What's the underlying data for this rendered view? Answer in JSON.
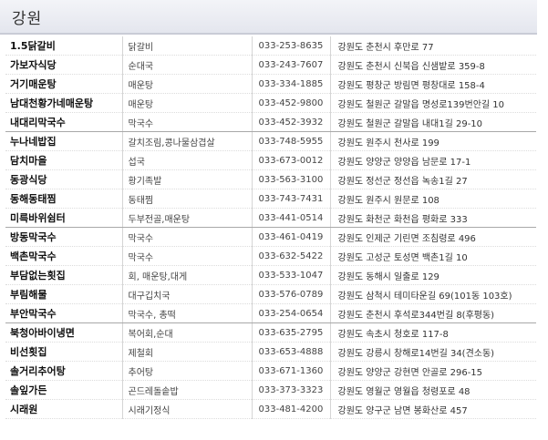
{
  "header": {
    "title": "강원"
  },
  "restaurants": [
    {
      "name": "1.5닭갈비",
      "food": "닭갈비",
      "phone": "033-253-8635",
      "address": "강원도 춘천시 후만로 77"
    },
    {
      "name": "가보자식당",
      "food": "순대국",
      "phone": "033-243-7607",
      "address": "강원도 춘천시 신북읍 신샘밭로 359-8"
    },
    {
      "name": "거기매운탕",
      "food": "매운탕",
      "phone": "033-334-1885",
      "address": "강원도 평창군 방림면 평창대로 158-4"
    },
    {
      "name": "남대천황가네매운탕",
      "food": "매운탕",
      "phone": "033-452-9800",
      "address": "강원도 철원군 갈말읍 명성로139번안길 10"
    },
    {
      "name": "내대리막국수",
      "food": "막국수",
      "phone": "033-452-3932",
      "address": "강원도 철원군 갈말읍 내대1길 29-10"
    },
    {
      "name": "누나네밥집",
      "food": "갈치조림,콩나물삼겹살",
      "phone": "033-748-5955",
      "address": "강원도 원주시 천사로 199"
    },
    {
      "name": "담치마을",
      "food": "섭국",
      "phone": "033-673-0012",
      "address": "강원도 양양군 양양읍 남문로 17-1"
    },
    {
      "name": "동광식당",
      "food": "황기족발",
      "phone": "033-563-3100",
      "address": "강원도 정선군 정선읍 녹송1길 27"
    },
    {
      "name": "동해동태찜",
      "food": "동태찜",
      "phone": "033-743-7431",
      "address": "강원도 원주시 원문로 108"
    },
    {
      "name": "미륵바위쉼터",
      "food": "두부전골,매운탕",
      "phone": "033-441-0514",
      "address": "강원도 화천군 화천읍 평화로 333"
    },
    {
      "name": "방동막국수",
      "food": "막국수",
      "phone": "033-461-0419",
      "address": "강원도 인제군 기린면 조침령로 496"
    },
    {
      "name": "백촌막국수",
      "food": "막국수",
      "phone": "033-632-5422",
      "address": "강원도 고성군 토성면 백촌1길 10"
    },
    {
      "name": "부담없는횟집",
      "food": "회, 매운탕,대게",
      "phone": "033-533-1047",
      "address": "강원도 동해시 일출로 129"
    },
    {
      "name": "부림해물",
      "food": "대구깁치국",
      "phone": "033-576-0789",
      "address": "강원도 삼척시 테미타운길 69(101동 103호)"
    },
    {
      "name": "부안막국수",
      "food": "막국수, 총떡",
      "phone": "033-254-0654",
      "address": "강원도 춘천시 후석로344번길 8(후평동)"
    },
    {
      "name": "북청아바이냉면",
      "food": "복어회,순대",
      "phone": "033-635-2795",
      "address": "강원도 속초시 청호로 117-8"
    },
    {
      "name": "비선횟집",
      "food": "제철회",
      "phone": "033-653-4888",
      "address": "강원도 강릉시 창해로14번길 34(견소동)"
    },
    {
      "name": "솔거리추어탕",
      "food": "추어탕",
      "phone": "033-671-1360",
      "address": "강원도 양양군 강현면 안골로 296-15"
    },
    {
      "name": "솔잎가든",
      "food": "곤드레돌솥밥",
      "phone": "033-373-3323",
      "address": "강원도 영월군 영월읍 청령포로 48"
    },
    {
      "name": "시래원",
      "food": "시래기정식",
      "phone": "033-481-4200",
      "address": "강원도 양구군 남면 봉화산로 457"
    }
  ]
}
